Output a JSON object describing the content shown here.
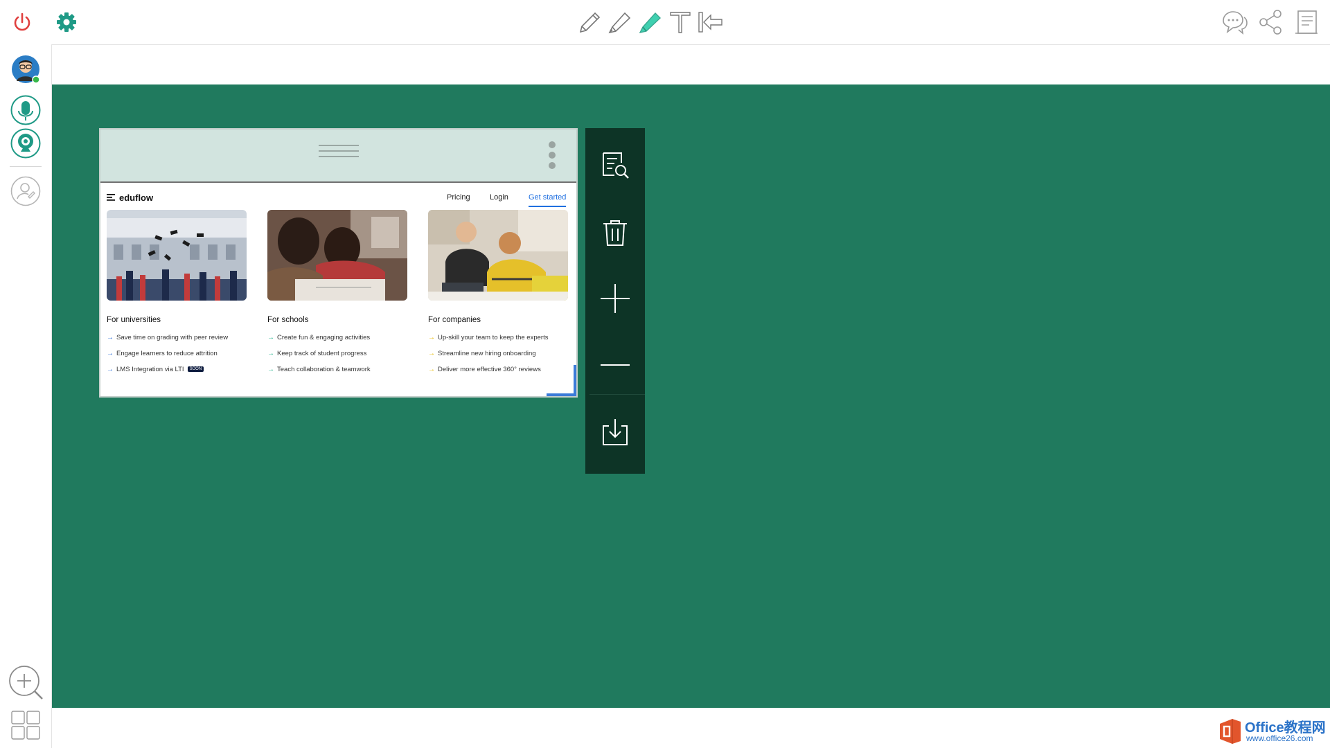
{
  "toolbar": {
    "left": [
      {
        "name": "power-icon",
        "color": "#e0403f"
      },
      {
        "name": "gear-icon",
        "color": "#1f9a86"
      }
    ],
    "center": [
      "pencil-icon",
      "marker-icon",
      "highlighter-icon",
      "text-icon",
      "back-arrow-icon"
    ],
    "highlighter_color": "#3fd0b0",
    "right": [
      "chat-icon",
      "share-icon",
      "notes-icon"
    ]
  },
  "sidebar": {
    "items": [
      "avatar",
      "microphone-icon",
      "webcam-icon",
      "user-add-icon"
    ],
    "status_color": "#36b84a",
    "accent": "#1f9a86",
    "bottom": [
      "zoom-in-icon",
      "grid-view-icon"
    ]
  },
  "canvas": {
    "background": "#207a5e"
  },
  "capture": {
    "site": {
      "logo": "eduflow",
      "nav": [
        "Pricing",
        "Login",
        "Get started"
      ],
      "columns": [
        {
          "title": "For universities",
          "arrow": "→",
          "arrow_color": "#2f6fd8",
          "features": [
            "Save time on grading with peer review",
            "Engage learners to reduce attrition",
            "LMS Integration via LTI"
          ],
          "badge": "SOON"
        },
        {
          "title": "For schools",
          "arrow": "→",
          "arrow_color": "#27b58f",
          "features": [
            "Create fun & engaging activities",
            "Keep track of student progress",
            "Teach collaboration & teamwork"
          ]
        },
        {
          "title": "For companies",
          "arrow": "→",
          "arrow_color": "#e6b800",
          "features": [
            "Up-skill your team to keep the experts",
            "Streamline new hiring onboarding",
            "Deliver more effective 360° reviews"
          ]
        }
      ]
    }
  },
  "tool_panel": {
    "buttons": [
      "search-doc-icon",
      "trash-icon",
      "plus-icon",
      "minus-icon",
      "download-icon"
    ]
  },
  "brand": {
    "name": "Office教程网",
    "url": "www.office26.com"
  }
}
